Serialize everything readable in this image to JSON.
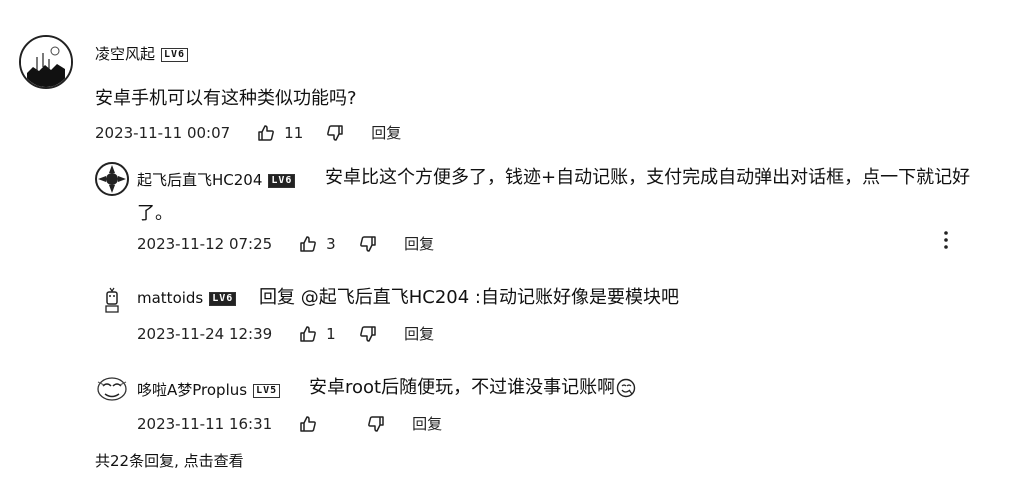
{
  "main_comment": {
    "username": "凌空风起",
    "level": "LV6",
    "text": "安卓手机可以有这种类似功能吗?",
    "time": "2023-11-11 00:07",
    "likes": "11",
    "reply_label": "回复"
  },
  "replies": [
    {
      "username": "起飞后直飞HC204",
      "level": "LV6",
      "text_line1": "安卓比这个方便多了，钱迹+自动记账，支付完成自动弹出对话框，点一下就记好",
      "text_line2": "了。",
      "time": "2023-11-12 07:25",
      "likes": "3",
      "reply_label": "回复"
    },
    {
      "username": "mattoids",
      "level": "LV6",
      "text": "回复 @起飞后直飞HC204 :自动记账好像是要模块吧",
      "time": "2023-11-24 12:39",
      "likes": "1",
      "reply_label": "回复"
    },
    {
      "username": "哆啦A梦Proplus",
      "level": "LV5",
      "text": "安卓root后随便玩，不过谁没事记账啊",
      "time": "2023-11-11 16:31",
      "likes": "",
      "reply_label": "回复"
    }
  ],
  "footer": {
    "view_all": "共22条回复, 点击查看"
  },
  "icons": [
    "thumb-up-icon",
    "thumb-down-icon",
    "more-vertical-icon",
    "emoji-icon"
  ]
}
